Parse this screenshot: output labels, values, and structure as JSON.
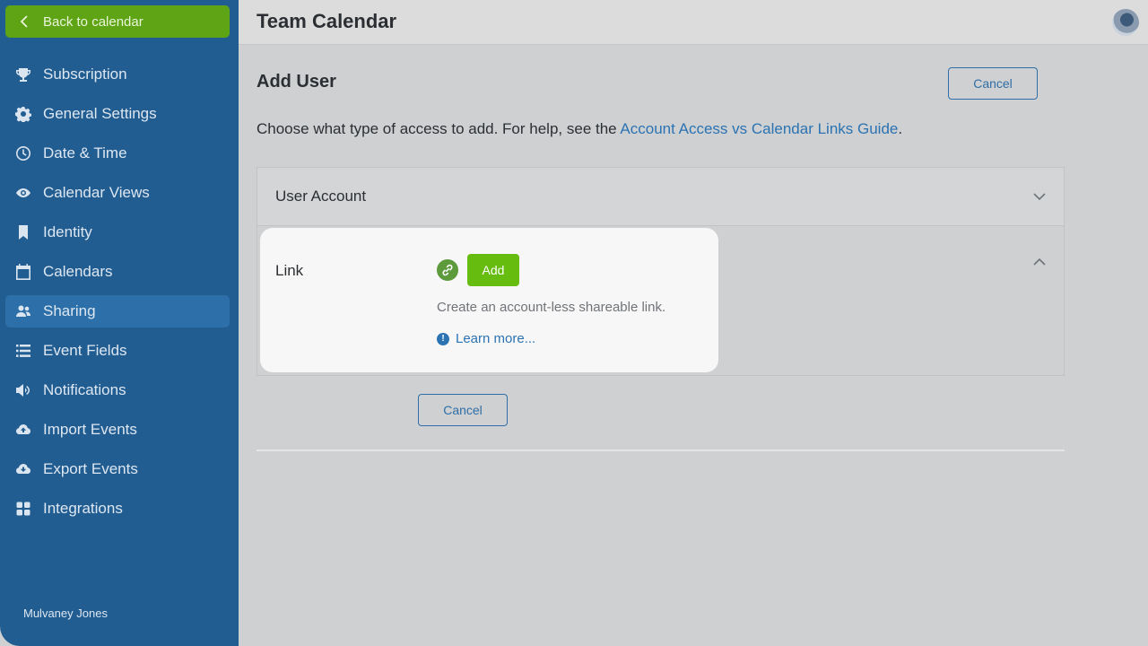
{
  "sidebar": {
    "back_label": "Back to calendar",
    "items": [
      {
        "label": "Subscription",
        "icon": "trophy-icon"
      },
      {
        "label": "General Settings",
        "icon": "gear-icon"
      },
      {
        "label": "Date & Time",
        "icon": "clock-icon"
      },
      {
        "label": "Calendar Views",
        "icon": "eye-icon"
      },
      {
        "label": "Identity",
        "icon": "bookmark-icon"
      },
      {
        "label": "Calendars",
        "icon": "calendar-icon"
      },
      {
        "label": "Sharing",
        "icon": "users-icon",
        "active": true
      },
      {
        "label": "Event Fields",
        "icon": "list-icon"
      },
      {
        "label": "Notifications",
        "icon": "megaphone-icon"
      },
      {
        "label": "Import Events",
        "icon": "cloud-upload-icon"
      },
      {
        "label": "Export Events",
        "icon": "cloud-download-icon"
      },
      {
        "label": "Integrations",
        "icon": "grid-icon"
      }
    ],
    "user_name": "Mulvaney Jones"
  },
  "header": {
    "title": "Team Calendar"
  },
  "main": {
    "page_title": "Add User",
    "cancel_label": "Cancel",
    "intro_text": "Choose what type of access to add. For help, see the ",
    "intro_link": "Account Access vs Calendar Links Guide",
    "intro_end": ".",
    "accordion": {
      "user_account_label": "User Account",
      "link_label": "Link",
      "add_label": "Add",
      "link_description": "Create an account-less shareable link.",
      "learn_more": "Learn more..."
    },
    "cancel_bottom_label": "Cancel"
  },
  "colors": {
    "sidebar": "#225d92",
    "back_button": "#5fa414",
    "add_button": "#66bd0f",
    "link": "#2b73b3"
  }
}
